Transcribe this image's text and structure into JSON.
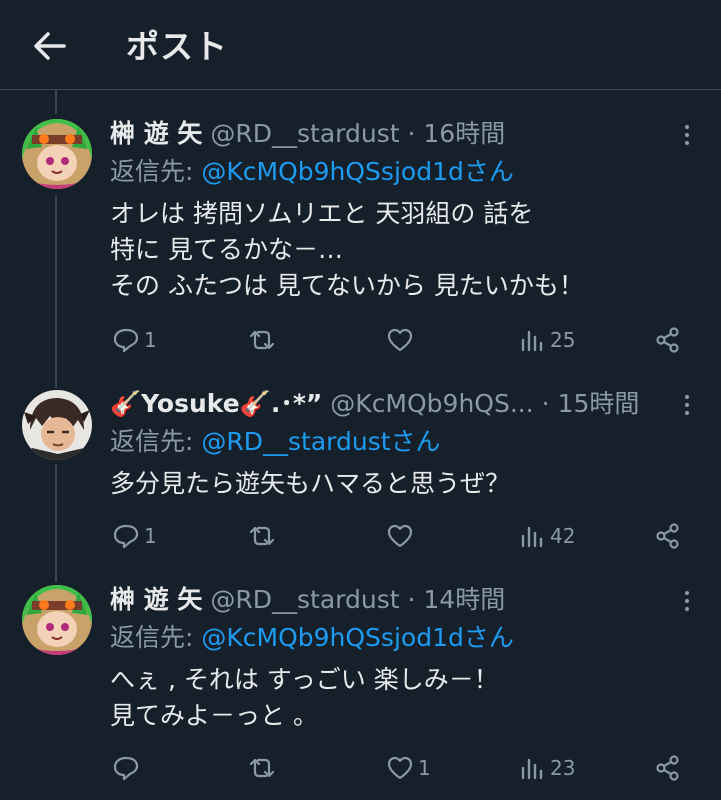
{
  "header": {
    "title": "ポスト"
  },
  "tweets": [
    {
      "name": "榊 遊 矢",
      "handle": "@RD__stardust",
      "dot": "·",
      "time": "16時間",
      "reply_prefix": "返信先: ",
      "reply_to": "@KcMQb9hQSsjod1dさん",
      "lines": [
        "オレは 拷問ソムリエと 天羽組の 話を",
        "特に 見てるかな－…",
        "その ふたつは 見てないから 見たいかも！"
      ],
      "replies": "1",
      "retweets": "",
      "likes": "",
      "views": "25"
    },
    {
      "name": "🎸Yosuke🎸.･*”",
      "handle": "@KcMQb9hQS...",
      "dot": "·",
      "time": "15時間",
      "reply_prefix": "返信先: ",
      "reply_to": "@RD__stardustさん",
      "lines": [
        "多分見たら遊矢もハマると思うぜ？"
      ],
      "replies": "1",
      "retweets": "",
      "likes": "",
      "views": "42"
    },
    {
      "name": "榊 遊 矢",
      "handle": "@RD__stardust",
      "dot": "·",
      "time": "14時間",
      "reply_prefix": "返信先: ",
      "reply_to": "@KcMQb9hQSsjod1dさん",
      "lines": [
        "へぇ , それは すっごい 楽しみ－！",
        "見てみよ－っと 。"
      ],
      "replies": "",
      "retweets": "",
      "likes": "1",
      "views": "23"
    }
  ],
  "icons": {
    "back": "arrow-left-icon",
    "more": "more-vertical-icon",
    "reply": "reply-icon",
    "retweet": "retweet-icon",
    "like": "heart-icon",
    "views": "views-icon",
    "share": "share-icon"
  },
  "colors": {
    "background": "#15202b",
    "accent": "#1d9bf0",
    "muted": "#8b98a5",
    "text": "#e7e9ea",
    "border": "#38444d"
  }
}
